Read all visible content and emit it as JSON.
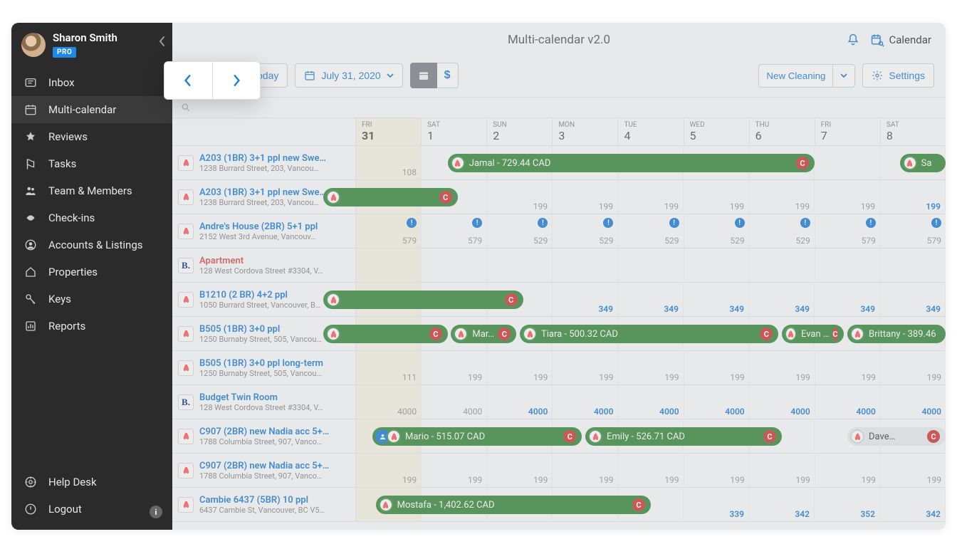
{
  "user": {
    "name": "Sharon Smith",
    "badge": "PRO"
  },
  "nav": [
    {
      "id": "inbox",
      "label": "Inbox"
    },
    {
      "id": "multi-calendar",
      "label": "Multi-calendar"
    },
    {
      "id": "reviews",
      "label": "Reviews"
    },
    {
      "id": "tasks",
      "label": "Tasks"
    },
    {
      "id": "team",
      "label": "Team & Members"
    },
    {
      "id": "checkins",
      "label": "Check-ins"
    },
    {
      "id": "accounts",
      "label": "Accounts & Listings"
    },
    {
      "id": "properties",
      "label": "Properties"
    },
    {
      "id": "keys",
      "label": "Keys"
    },
    {
      "id": "reports",
      "label": "Reports"
    }
  ],
  "navBottom": [
    {
      "id": "helpdesk",
      "label": "Help Desk"
    },
    {
      "id": "logout",
      "label": "Logout"
    }
  ],
  "header": {
    "title": "Multi-calendar v2.0",
    "calendarLink": "Calendar"
  },
  "toolbar": {
    "today": "oday",
    "date": "July 31, 2020",
    "newCleaning": "New Cleaning",
    "settings": "Settings"
  },
  "days": [
    {
      "dow": "FRI",
      "num": "31",
      "first": true
    },
    {
      "dow": "SAT",
      "num": "1"
    },
    {
      "dow": "SUN",
      "num": "2"
    },
    {
      "dow": "MON",
      "num": "3"
    },
    {
      "dow": "TUE",
      "num": "4"
    },
    {
      "dow": "WED",
      "num": "5"
    },
    {
      "dow": "THU",
      "num": "6"
    },
    {
      "dow": "FRI",
      "num": "7"
    },
    {
      "dow": "SAT",
      "num": "8"
    }
  ],
  "rows": [
    {
      "src": "ab",
      "title": "A203 (1BR) 3+1 ppl new Swe…",
      "addr": "1238 Burrard Street, 203, Vancou…",
      "prices": [
        {
          "i": 0,
          "v": "108"
        }
      ],
      "bookings": [
        {
          "label": "Jamal - 729.44 CAD",
          "start": 1.4,
          "end": 7,
          "badge": "C"
        },
        {
          "label": "Sa",
          "start": 8.3,
          "end": 9,
          "light": false,
          "partial": true
        }
      ]
    },
    {
      "src": "ab",
      "title": "A203 (1BR) 3+1 ppl new Swe…",
      "addr": "1238 Burrard Street, 203, Vancou…",
      "prices": [
        {
          "i": 2,
          "v": "199"
        },
        {
          "i": 3,
          "v": "199"
        },
        {
          "i": 4,
          "v": "199"
        },
        {
          "i": 5,
          "v": "199"
        },
        {
          "i": 6,
          "v": "199"
        },
        {
          "i": 7,
          "v": "199"
        },
        {
          "i": 8,
          "v": "199",
          "blue": true
        }
      ],
      "bookings": [
        {
          "label": "",
          "start": -0.5,
          "end": 1.55,
          "badge": "C"
        }
      ]
    },
    {
      "src": "ab",
      "title": "Andre's House (2BR) 5+1 ppl",
      "addr": "2152 West 3rd Avenue, Vancouv…",
      "prices": [
        {
          "i": 0,
          "v": "579"
        },
        {
          "i": 1,
          "v": "579"
        },
        {
          "i": 2,
          "v": "529"
        },
        {
          "i": 3,
          "v": "529"
        },
        {
          "i": 4,
          "v": "529"
        },
        {
          "i": 5,
          "v": "529"
        },
        {
          "i": 6,
          "v": "529"
        },
        {
          "i": 7,
          "v": "579"
        },
        {
          "i": 8,
          "v": "579"
        }
      ],
      "alerts": [
        0,
        1,
        2,
        3,
        4,
        5,
        6,
        7,
        8
      ]
    },
    {
      "src": "bk",
      "title": "Apartment",
      "red": true,
      "addr": "128 West Cordova Street #3304, V…"
    },
    {
      "src": "ab",
      "title": "B1210 (2 BR) 4+2 ppl",
      "addr": "1050 Burrard Street, Vancouver, B…",
      "prices": [
        {
          "i": 3,
          "v": "349",
          "blue": true
        },
        {
          "i": 4,
          "v": "349",
          "blue": true
        },
        {
          "i": 5,
          "v": "349",
          "blue": true
        },
        {
          "i": 6,
          "v": "349",
          "blue": true
        },
        {
          "i": 7,
          "v": "349",
          "blue": true
        },
        {
          "i": 8,
          "v": "349",
          "blue": true
        }
      ],
      "bookings": [
        {
          "label": "",
          "start": -0.5,
          "end": 2.55,
          "badge": "C"
        }
      ]
    },
    {
      "src": "ab",
      "title": "B505 (1BR) 3+0 ppl",
      "addr": "1250 Burnaby Street, 505, Vancou…",
      "bookings": [
        {
          "label": "",
          "start": -0.5,
          "end": 1.4,
          "badge": "C"
        },
        {
          "label": "Mar…",
          "start": 1.45,
          "end": 2.45,
          "badge": "C"
        },
        {
          "label": "Tiara - 500.32 CAD",
          "start": 2.5,
          "end": 6.45,
          "badge": "C"
        },
        {
          "label": "Evan …",
          "start": 6.5,
          "end": 7.45,
          "badge": "C"
        },
        {
          "label": "Brittany - 389.46",
          "start": 7.5,
          "end": 9
        }
      ]
    },
    {
      "src": "ab",
      "title": "B505 (1BR) 3+0 ppl long-term",
      "addr": "1250 Burnaby Street, 505, Vancou…",
      "prices": [
        {
          "i": 0,
          "v": "111"
        },
        {
          "i": 1,
          "v": "199"
        },
        {
          "i": 2,
          "v": "199"
        },
        {
          "i": 3,
          "v": "199"
        },
        {
          "i": 4,
          "v": "199"
        },
        {
          "i": 5,
          "v": "199"
        },
        {
          "i": 6,
          "v": "199"
        },
        {
          "i": 7,
          "v": "199"
        },
        {
          "i": 8,
          "v": "199"
        }
      ]
    },
    {
      "src": "bk",
      "title": "Budget Twin Room",
      "addr": "128 West Cordova Street #3304, V…",
      "prices": [
        {
          "i": 0,
          "v": "4000"
        },
        {
          "i": 1,
          "v": "4000"
        },
        {
          "i": 2,
          "v": "4000",
          "blue": true
        },
        {
          "i": 3,
          "v": "4000",
          "blue": true
        },
        {
          "i": 4,
          "v": "4000",
          "blue": true
        },
        {
          "i": 5,
          "v": "4000",
          "blue": true
        },
        {
          "i": 6,
          "v": "4000",
          "blue": true
        },
        {
          "i": 7,
          "v": "4000",
          "blue": true
        },
        {
          "i": 8,
          "v": "4000",
          "blue": true
        }
      ]
    },
    {
      "src": "ab",
      "title": "C907 (2BR) new Nadia acc 5+…",
      "addr": "1788 Columbia Street, 907, Vanco…",
      "bookings": [
        {
          "label": "Mario - 515.07 CAD",
          "start": 0.25,
          "end": 3.45,
          "badge": "C",
          "user": true
        },
        {
          "label": "Emily - 526.71 CAD",
          "start": 3.5,
          "end": 6.5,
          "badge": "C"
        },
        {
          "label": "Dave…",
          "start": 7.5,
          "end": 9,
          "light": true,
          "badge": "C"
        }
      ]
    },
    {
      "src": "ab",
      "title": "C907 (2BR) new Nadia acc 5+…",
      "addr": "1788 Columbia Street, 907, Vanco…",
      "prices": [
        {
          "i": 0,
          "v": "199"
        },
        {
          "i": 1,
          "v": "199"
        },
        {
          "i": 2,
          "v": "199"
        },
        {
          "i": 3,
          "v": "199"
        },
        {
          "i": 4,
          "v": "199"
        },
        {
          "i": 5,
          "v": "199"
        },
        {
          "i": 6,
          "v": "199"
        },
        {
          "i": 7,
          "v": "199"
        },
        {
          "i": 8,
          "v": "199"
        }
      ]
    },
    {
      "src": "ab",
      "title": "Cambie 6437 (5BR) 10 ppl",
      "addr": "6437 Cambie St, Vancouver, BC V5…",
      "prices": [
        {
          "i": 5,
          "v": "339",
          "blue": true
        },
        {
          "i": 6,
          "v": "342",
          "blue": true
        },
        {
          "i": 7,
          "v": "352",
          "blue": true
        },
        {
          "i": 8,
          "v": "342",
          "blue": true
        }
      ],
      "bookings": [
        {
          "label": "Mostafa - 1,402.62 CAD",
          "start": 0.3,
          "end": 4.5,
          "badge": "C"
        }
      ]
    }
  ]
}
